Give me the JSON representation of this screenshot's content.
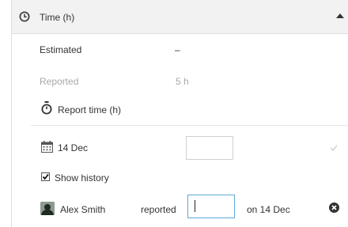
{
  "header": {
    "title": "Time (h)"
  },
  "estimated": {
    "label": "Estimated",
    "value": "–"
  },
  "reported": {
    "label": "Reported",
    "value": "5 h"
  },
  "report_time": {
    "label": "Report time (h)"
  },
  "entry": {
    "date": "14 Dec",
    "hours_value": ""
  },
  "show_history": {
    "label": "Show history",
    "checked": true
  },
  "history": [
    {
      "user": "Alex Smith",
      "action": "reported",
      "hours_value": "",
      "date": "on 14 Dec"
    }
  ],
  "colors": {
    "header_bg": "#f2f2f2",
    "muted": "#a8a8a8",
    "focus_border": "#5fa8d8"
  }
}
